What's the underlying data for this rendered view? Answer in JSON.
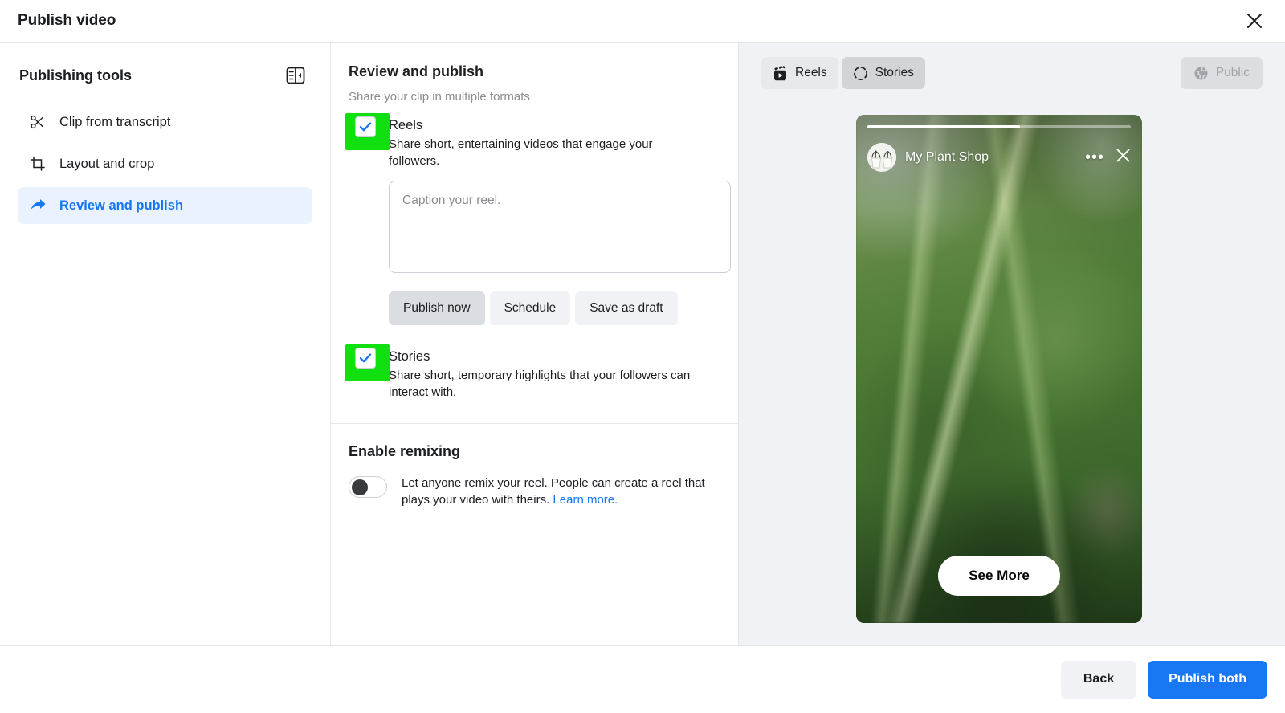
{
  "window": {
    "title": "Publish video",
    "close_icon": "close-icon"
  },
  "sidebar": {
    "title": "Publishing tools",
    "collapse_icon": "panel-collapse-icon",
    "items": [
      {
        "label": "Clip from transcript",
        "icon": "scissors-icon",
        "active": false
      },
      {
        "label": "Layout and crop",
        "icon": "crop-icon",
        "active": false
      },
      {
        "label": "Review and publish",
        "icon": "share-arrow-icon",
        "active": true
      }
    ]
  },
  "main": {
    "title": "Review and publish",
    "subtitle": "Share your clip in multiple formats",
    "reels": {
      "checked": true,
      "name": "Reels",
      "description": "Share short, entertaining videos that engage your followers.",
      "caption_placeholder": "Caption your reel.",
      "caption_value": "",
      "buttons": [
        {
          "label": "Publish now",
          "selected": true
        },
        {
          "label": "Schedule",
          "selected": false
        },
        {
          "label": "Save as draft",
          "selected": false
        }
      ]
    },
    "stories": {
      "checked": true,
      "name": "Stories",
      "description": "Share short, temporary highlights that your followers can interact with."
    },
    "remixing": {
      "title": "Enable remixing",
      "enabled": false,
      "description": "Let anyone remix your reel. People can create a reel that plays your video with theirs.",
      "link_label": "Learn more."
    }
  },
  "preview": {
    "tabs": [
      {
        "label": "Reels",
        "icon": "reels-clapper-icon",
        "active": false
      },
      {
        "label": "Stories",
        "icon": "story-ring-icon",
        "active": true
      }
    ],
    "audience_badge": {
      "label": "Public",
      "icon": "globe-icon"
    },
    "story": {
      "progress_percent": 58,
      "page_name": "My Plant Shop",
      "avatar_icon": "plant-pot-avatar",
      "more_icon": "more-dots-icon",
      "close_icon": "close-icon",
      "cta_label": "See More"
    }
  },
  "footer": {
    "back_label": "Back",
    "publish_label": "Publish both"
  },
  "annotations": {
    "arrow_color": "#10e010",
    "highlight_color": "#10e010"
  }
}
